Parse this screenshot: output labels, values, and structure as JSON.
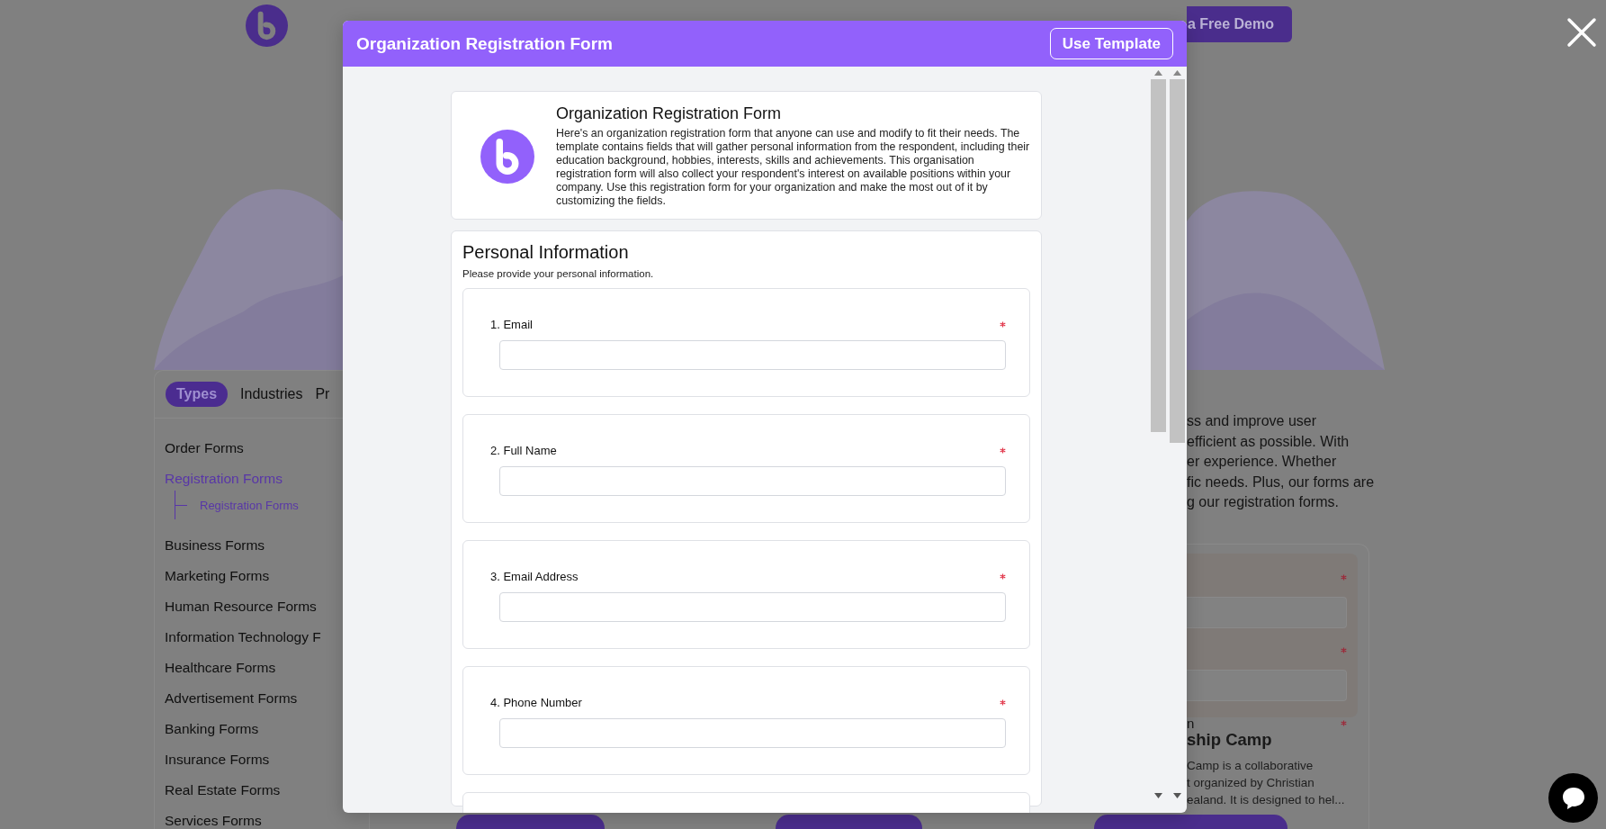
{
  "header": {
    "demo_button": "a Free Demo"
  },
  "sidebar": {
    "tabs": [
      {
        "label": "Types",
        "selected": true
      },
      {
        "label": "Industries",
        "selected": false
      },
      {
        "label": "Pr",
        "selected": false
      }
    ],
    "items": [
      {
        "label": "Order Forms",
        "selected": false
      },
      {
        "label": "Registration Forms",
        "selected": true,
        "children": [
          {
            "label": "Registration Forms",
            "selected": true
          }
        ]
      },
      {
        "label": "Business Forms",
        "selected": false
      },
      {
        "label": "Marketing Forms",
        "selected": false
      },
      {
        "label": "Human Resource Forms",
        "selected": false
      },
      {
        "label": "Information Technology F",
        "selected": false
      },
      {
        "label": "Healthcare Forms",
        "selected": false
      },
      {
        "label": "Advertisement Forms",
        "selected": false
      },
      {
        "label": "Banking Forms",
        "selected": false
      },
      {
        "label": "Insurance Forms",
        "selected": false
      },
      {
        "label": "Real Estate Forms",
        "selected": false
      },
      {
        "label": "Services Forms",
        "selected": false
      }
    ]
  },
  "intro_lines": [
    "ss and improve user",
    "efficient as possible. With",
    "er experience. Whether",
    "fic needs. Plus, our forms are",
    "g our registration forms."
  ],
  "template_card": {
    "preview_fields": [
      {
        "required": true
      },
      {
        "required": true
      },
      {
        "label": "n",
        "required": true
      }
    ],
    "title": "ship Camp",
    "description_lines": [
      "Camp is a collaborative",
      "t organized by Christian",
      "ealand. It is designed to hel..."
    ]
  },
  "modal": {
    "title": "Organization Registration Form",
    "use_template_button": "Use Template",
    "form": {
      "title": "Organization Registration Form",
      "description": "Here's an organization registration form that anyone can use and modify to fit their needs. The template contains fields that will gather personal information from the respondent, including their education background, hobbies, interests, skills and achievements. This organisation registration form will also collect your respondent's interest on available positions within your company. Use this registration form for your organization and make the most out of it by customizing the fields."
    },
    "section": {
      "title": "Personal Information",
      "subtitle": "Please provide your personal information."
    },
    "questions": [
      {
        "label": "1. Email",
        "required": true
      },
      {
        "label": "2. Full Name",
        "required": true
      },
      {
        "label": "3. Email Address",
        "required": true
      },
      {
        "label": "4. Phone Number",
        "required": true
      },
      {
        "required": false
      }
    ]
  }
}
